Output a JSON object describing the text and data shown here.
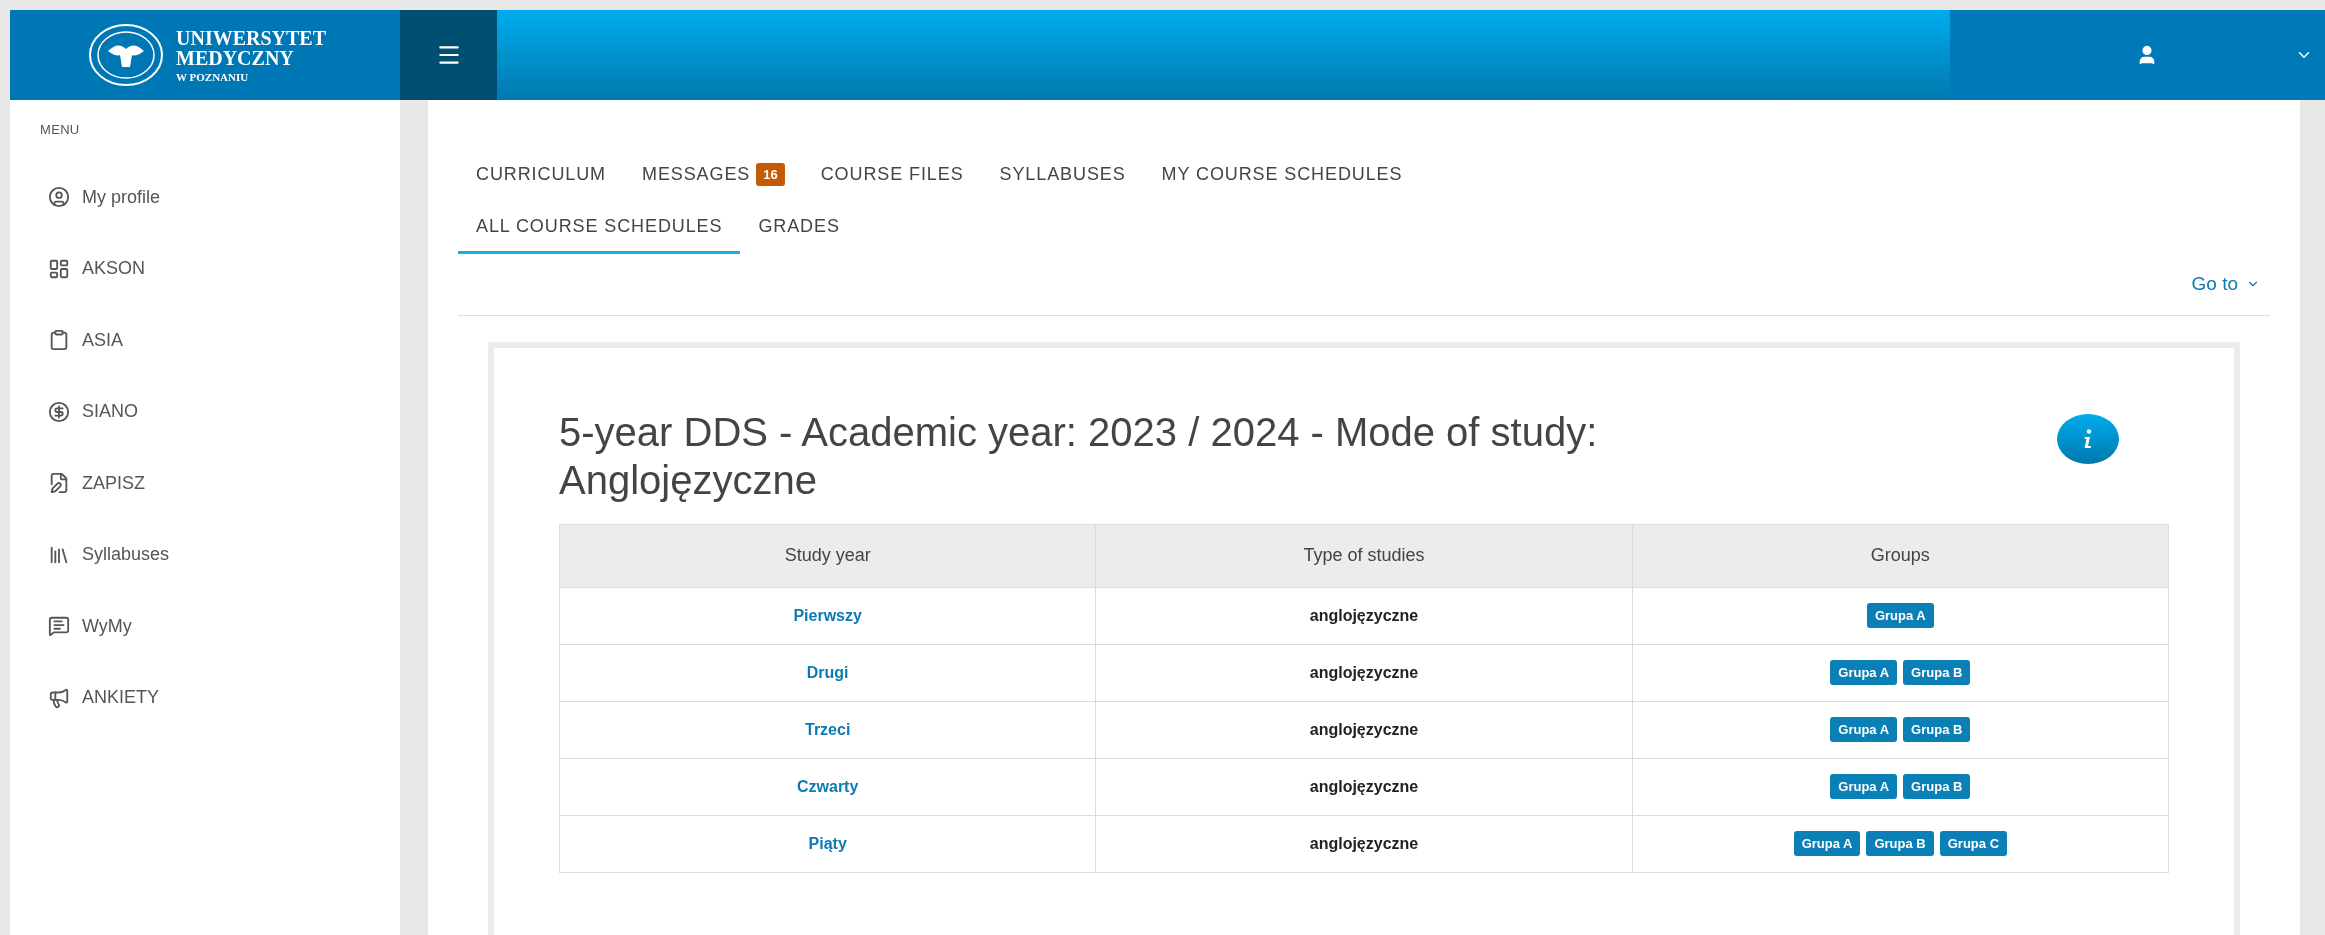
{
  "header": {
    "logo_lines": [
      "UNIWERSYTET",
      "MEDYCZNY",
      "W POZNANIU"
    ]
  },
  "sidebar": {
    "heading": "MENU",
    "items": [
      {
        "label": "My profile",
        "kind": "profile"
      },
      {
        "label": "AKSON",
        "kind": "dashboard"
      },
      {
        "label": "ASIA",
        "kind": "clipboard"
      },
      {
        "label": "SIANO",
        "kind": "coin"
      },
      {
        "label": "ZAPISZ",
        "kind": "edit"
      },
      {
        "label": "Syllabuses",
        "kind": "books"
      },
      {
        "label": "WyMy",
        "kind": "note"
      },
      {
        "label": "ANKIETY",
        "kind": "speaker"
      }
    ]
  },
  "tabs": [
    {
      "label": "CURRICULUM",
      "selected": false
    },
    {
      "label": "MESSAGES",
      "badge": "16",
      "selected": false
    },
    {
      "label": "COURSE FILES",
      "selected": false
    },
    {
      "label": "SYLLABUSES",
      "selected": false
    },
    {
      "label": "MY COURSE SCHEDULES",
      "selected": false
    },
    {
      "label": "ALL COURSE SCHEDULES",
      "selected": true
    },
    {
      "label": "GRADES",
      "selected": false
    }
  ],
  "goto": "Go to",
  "card": {
    "title": "5-year DDS - Academic year: 2023 / 2024 - Mode of study: Anglojęzyczne",
    "table": {
      "columns": [
        "Study year",
        "Type of studies",
        "Groups"
      ],
      "rows": [
        {
          "year": "Pierwszy",
          "type": "anglojęzyczne",
          "groups": [
            "Grupa A"
          ]
        },
        {
          "year": "Drugi",
          "type": "anglojęzyczne",
          "groups": [
            "Grupa A",
            "Grupa B"
          ]
        },
        {
          "year": "Trzeci",
          "type": "anglojęzyczne",
          "groups": [
            "Grupa A",
            "Grupa B"
          ]
        },
        {
          "year": "Czwarty",
          "type": "anglojęzyczne",
          "groups": [
            "Grupa A",
            "Grupa B"
          ]
        },
        {
          "year": "Piąty",
          "type": "anglojęzyczne",
          "groups": [
            "Grupa A",
            "Grupa B",
            "Grupa C"
          ]
        }
      ]
    }
  }
}
